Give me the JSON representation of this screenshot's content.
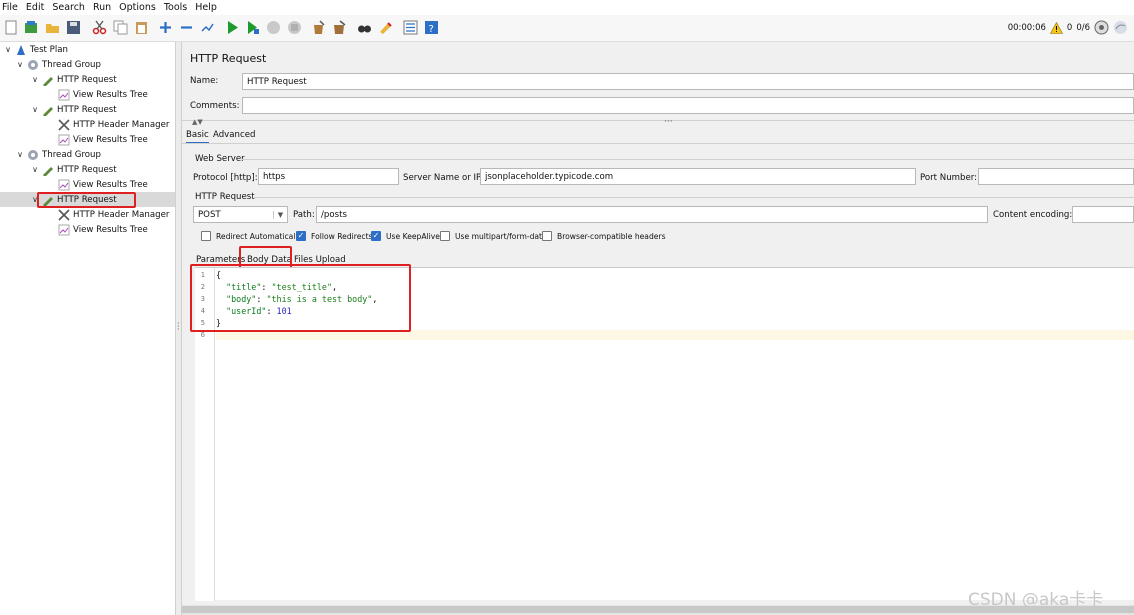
{
  "menu": [
    "File",
    "Edit",
    "Search",
    "Run",
    "Options",
    "Tools",
    "Help"
  ],
  "toolbar": {
    "timer": "00:00:06",
    "warnings": "0",
    "threads": "0/6"
  },
  "tree": {
    "test_plan": "Test Plan",
    "thread_group_1": "Thread Group",
    "http_request_1": "HTTP Request",
    "results_tree_1": "View Results Tree",
    "http_request_2": "HTTP Request",
    "header_manager_1": "HTTP Header Manager",
    "results_tree_2": "View Results Tree",
    "thread_group_2": "Thread Group",
    "http_request_3": "HTTP Request",
    "results_tree_3": "View Results Tree",
    "http_request_4": "HTTP Request",
    "header_manager_2": "HTTP Header Manager",
    "results_tree_4": "View Results Tree"
  },
  "panel": {
    "title": "HTTP Request",
    "name_label": "Name:",
    "name_value": "HTTP Request",
    "comments_label": "Comments:",
    "comments_value": "",
    "tabs": [
      "Basic",
      "Advanced"
    ],
    "web_server_label": "Web Server",
    "protocol_label": "Protocol [http]:",
    "protocol_value": "https",
    "server_label": "Server Name or IP:",
    "server_value": "jsonplaceholder.typicode.com",
    "port_label": "Port Number:",
    "port_value": "",
    "http_request_label": "HTTP Request",
    "method_value": "POST",
    "path_label": "Path:",
    "path_value": "/posts",
    "encoding_label": "Content encoding:",
    "encoding_value": "",
    "checkboxes": [
      {
        "label": "Redirect Automatically",
        "checked": false
      },
      {
        "label": "Follow Redirects",
        "checked": true
      },
      {
        "label": "Use KeepAlive",
        "checked": true
      },
      {
        "label": "Use multipart/form-data",
        "checked": false
      },
      {
        "label": "Browser-compatible headers",
        "checked": false
      }
    ],
    "subtabs": [
      "Parameters",
      "Body Data",
      "Files Upload"
    ]
  },
  "editor": {
    "line_numbers": [
      "1",
      "2",
      "3",
      "4",
      "5",
      "6"
    ],
    "lines": {
      "l1": "{",
      "l2_key": "\"title\"",
      "l2_val": "\"test_title\"",
      "l3_key": "\"body\"",
      "l3_val": "\"this is a test body\"",
      "l4_key": "\"userId\"",
      "l4_val": "101",
      "l5": "}"
    }
  },
  "watermark": "CSDN @aka卡卡",
  "colors": {
    "highlight_box": "#e02020",
    "checkbox_checked": "#2d6fc7",
    "json_key": "#0c7b1f",
    "json_number": "#2727c9"
  }
}
